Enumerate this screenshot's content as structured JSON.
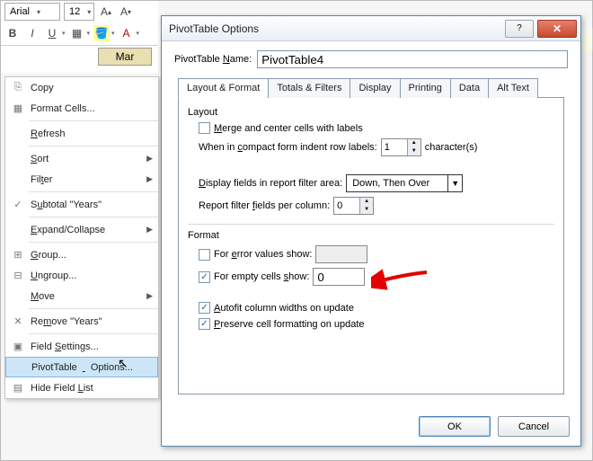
{
  "ribbon": {
    "font_name": "Arial",
    "font_size": "12",
    "percent": "%",
    "comma": ",",
    "bold": "B",
    "italic": "I",
    "underline": "U"
  },
  "grid": {
    "col_header": "Mar"
  },
  "context": {
    "items": [
      {
        "icon": "⎘",
        "label": "Copy",
        "arrow": false
      },
      {
        "icon": "▦",
        "label": "Format Cells...",
        "arrow": false
      },
      {
        "sep": true
      },
      {
        "icon": "",
        "label": "Refresh",
        "u": 0,
        "arrow": false
      },
      {
        "sep": true
      },
      {
        "icon": "",
        "label": "Sort",
        "u": 0,
        "arrow": true
      },
      {
        "icon": "",
        "label": "Filter",
        "u": 3,
        "arrow": true
      },
      {
        "sep": true
      },
      {
        "icon": "✓",
        "label": "Subtotal \"Years\"",
        "u": 1,
        "arrow": false
      },
      {
        "sep": true
      },
      {
        "icon": "",
        "label": "Expand/Collapse",
        "u": 0,
        "arrow": true
      },
      {
        "sep": true
      },
      {
        "icon": "⊞",
        "label": "Group...",
        "u": 0,
        "arrow": false
      },
      {
        "icon": "⊟",
        "label": "Ungroup...",
        "u": 0,
        "arrow": false
      },
      {
        "icon": "",
        "label": "Move",
        "u": 0,
        "arrow": true
      },
      {
        "sep": true
      },
      {
        "icon": "✕",
        "label": "Remove \"Years\"",
        "u": 2,
        "arrow": false
      },
      {
        "sep": true
      },
      {
        "icon": "▣",
        "label": "Field Settings...",
        "u": 6,
        "arrow": false
      },
      {
        "icon": "",
        "label": "PivotTable Options...",
        "u": 10,
        "arrow": false,
        "sel": true
      },
      {
        "icon": "▤",
        "label": "Hide Field List",
        "u": 11,
        "arrow": false
      }
    ]
  },
  "dialog": {
    "title": "PivotTable Options",
    "name_label": "PivotTable Name:",
    "name_value": "PivotTable4",
    "tabs": [
      "Layout & Format",
      "Totals & Filters",
      "Display",
      "Printing",
      "Data",
      "Alt Text"
    ],
    "layout_title": "Layout",
    "merge_label": "Merge and center cells with labels",
    "merge_checked": false,
    "indent_label_pre": "When in compact form indent row labels:",
    "indent_value": "1",
    "indent_label_post": "character(s)",
    "filter_area_label": "Display fields in report filter area:",
    "filter_area_value": "Down, Then Over",
    "fields_per_col_label": "Report filter fields per column:",
    "fields_per_col_value": "0",
    "format_title": "Format",
    "err_label": "For error values show:",
    "err_checked": false,
    "err_value": "",
    "empty_label": "For empty cells show:",
    "empty_checked": true,
    "empty_value": "0",
    "autofit_label": "Autofit column widths on update",
    "autofit_checked": true,
    "preserve_label": "Preserve cell formatting on update",
    "preserve_checked": true,
    "ok": "OK",
    "cancel": "Cancel"
  }
}
